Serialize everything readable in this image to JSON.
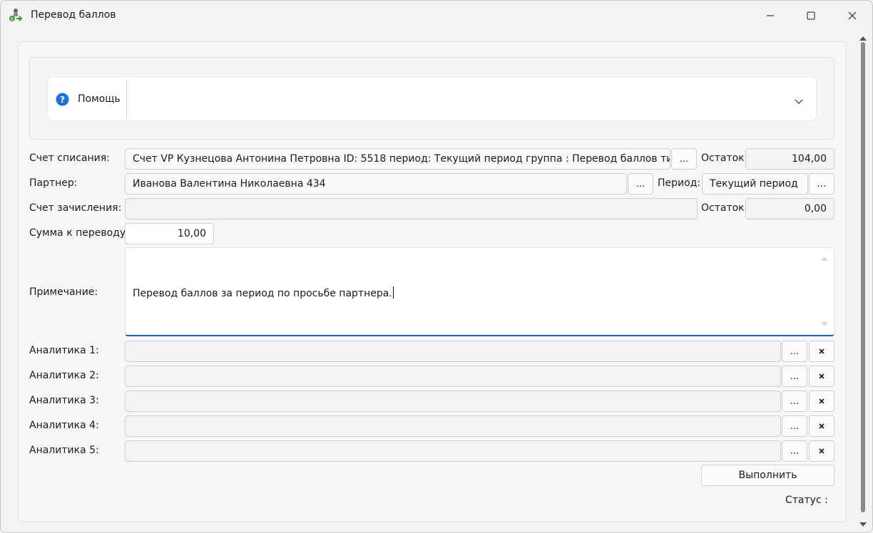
{
  "window": {
    "title": "Перевод баллов"
  },
  "help": {
    "label": "Помощь"
  },
  "form": {
    "debit_account_label": "Счет списания:",
    "debit_account_value": "Счет VP Кузнецова Антонина Петровна ID: 5518 период: Текущий период группа : Перевод баллов тип: Акти",
    "debit_balance_label": "Остаток:",
    "debit_balance_value": "104,00",
    "partner_label": "Партнер:",
    "partner_value": "Иванова Валентина Николаевна 434",
    "period_label": "Период:",
    "period_value": "Текущий период",
    "credit_account_label": "Счет зачисления:",
    "credit_account_value": "",
    "credit_balance_label": "Остаток:",
    "credit_balance_value": "0,00",
    "amount_label": "Сумма к переводу:",
    "amount_value": "10,00",
    "note_label": "Примечание:",
    "note_value": "Перевод баллов за период по просьбе партнера.",
    "dots_label": "...",
    "analytics": [
      {
        "label": "Аналитика 1:",
        "value": ""
      },
      {
        "label": "Аналитика 2:",
        "value": ""
      },
      {
        "label": "Аналитика 3:",
        "value": ""
      },
      {
        "label": "Аналитика 4:",
        "value": ""
      },
      {
        "label": "Аналитика 5:",
        "value": ""
      }
    ],
    "execute_label": "Выполнить",
    "status_label": "Статус  :"
  },
  "colors": {
    "accent": "#1f5fb5",
    "help_icon": "#1a73d9"
  },
  "icons": [
    "app-icon",
    "minimize-icon",
    "maximize-icon",
    "close-icon",
    "help-question-icon",
    "chevron-down-icon",
    "clear-x-icon"
  ]
}
